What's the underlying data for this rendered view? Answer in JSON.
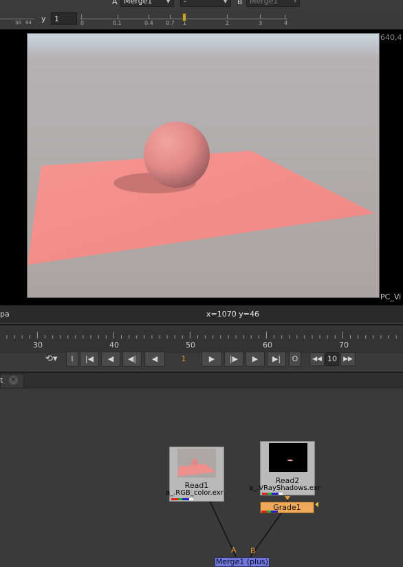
{
  "viewer_toolbar": {
    "input_a_tag": "A",
    "input_a_value": "Merge1",
    "compare_mode": "-",
    "input_b_tag": "B",
    "input_b_value": "Merge1",
    "gamma_ruler_labels": [
      "30",
      "64"
    ],
    "y_label": "y",
    "y_value": "1",
    "gain_ticks": [
      "0",
      "0.1",
      "0.4",
      "0.7",
      "1",
      "2",
      "3",
      "4"
    ]
  },
  "viewer": {
    "resolution_label": "640,4",
    "format_label": "PC_Vi"
  },
  "info_bar": {
    "channel_label": "pa",
    "coordinates": "x=1070 y=46"
  },
  "timeline": {
    "tick_labels": [
      "30",
      "40",
      "50",
      "60",
      "70"
    ],
    "current_frame": "1",
    "increment": "10",
    "buttons": {
      "in_point": "I",
      "out_point": "O"
    }
  },
  "node_graph": {
    "tab_label": "t",
    "nodes": {
      "read1": {
        "title": "Read1",
        "file": "a_.RGB_color.exr"
      },
      "read2": {
        "title": "Read2",
        "file": "a_.VRayShadows.exr"
      },
      "grade1": {
        "title": "Grade1"
      },
      "merge1": {
        "title": "Merge1 (plus)"
      }
    },
    "merge_inputs": {
      "a": "A",
      "b": "B"
    }
  },
  "colors": {
    "frame_accent": "#e59b36",
    "grade_node": "#f0a95a",
    "merge_node": "#6f78d6",
    "read_node": "#b9b9b9"
  }
}
